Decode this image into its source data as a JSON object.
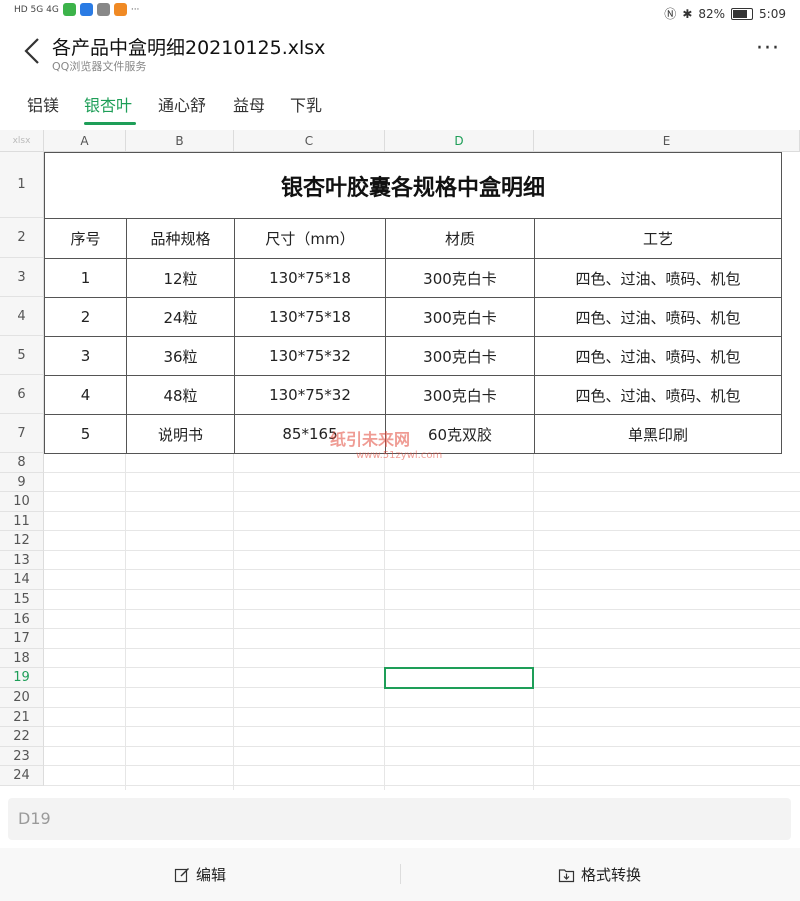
{
  "status_bar": {
    "left_text": "HD 5G 4G",
    "ellipsis": "···",
    "battery": "82%",
    "time": "5:09"
  },
  "header": {
    "title": "各产品中盒明细20210125.xlsx",
    "subtitle": "QQ浏览器文件服务",
    "more": "···"
  },
  "tabs": [
    {
      "label": "铝镁",
      "active": false
    },
    {
      "label": "银杏叶",
      "active": true
    },
    {
      "label": "通心舒",
      "active": false
    },
    {
      "label": "益母",
      "active": false
    },
    {
      "label": "下乳",
      "active": false
    }
  ],
  "sheet": {
    "corner": "xlsx",
    "columns": [
      "A",
      "B",
      "C",
      "D",
      "E"
    ],
    "row_numbers": [
      "1",
      "2",
      "3",
      "4",
      "5",
      "6",
      "7",
      "8",
      "9",
      "10",
      "11",
      "12",
      "13",
      "14",
      "15",
      "16",
      "17",
      "18",
      "19",
      "20",
      "21",
      "22",
      "23",
      "24"
    ],
    "title": "银杏叶胶囊各规格中盒明细",
    "header_row": [
      "序号",
      "品种规格",
      "尺寸（mm）",
      "材质",
      "工艺"
    ],
    "rows": [
      [
        "1",
        "12粒",
        "130*75*18",
        "300克白卡",
        "四色、过油、喷码、机包"
      ],
      [
        "2",
        "24粒",
        "130*75*18",
        "300克白卡",
        "四色、过油、喷码、机包"
      ],
      [
        "3",
        "36粒",
        "130*75*32",
        "300克白卡",
        "四色、过油、喷码、机包"
      ],
      [
        "4",
        "48粒",
        "130*75*32",
        "300克白卡",
        "四色、过油、喷码、机包"
      ],
      [
        "5",
        "说明书",
        "85*165",
        "60克双胶",
        "单黑印刷"
      ]
    ],
    "selected_cell": "D19",
    "accent_color": "#1e9e58"
  },
  "watermark": {
    "name": "纸引未来网",
    "url": "www.51zywl.com"
  },
  "namebox": {
    "value": "D19"
  },
  "toolbar": {
    "edit": "编辑",
    "convert": "格式转换"
  }
}
